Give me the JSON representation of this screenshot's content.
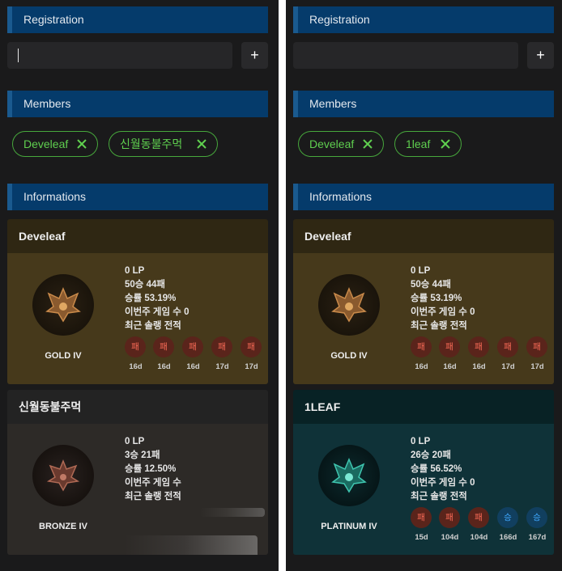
{
  "left": {
    "registration": {
      "title": "Registration",
      "input_value": "",
      "add_label": "+"
    },
    "members": {
      "title": "Members",
      "chips": [
        {
          "label": "Develeaf"
        },
        {
          "label": "신월동불주먹"
        }
      ]
    },
    "info": {
      "title": "Informations"
    },
    "cards": [
      {
        "name": "Develeaf",
        "theme": "gold",
        "tier": "GOLD IV",
        "lp": "0 LP",
        "record": "50승 44패",
        "winrate": "승률 53.19%",
        "week_games": "이번주 게임 수  0",
        "recent_label": "최근 솔랭 전적",
        "games": [
          {
            "result": "패",
            "ago": "16d"
          },
          {
            "result": "패",
            "ago": "16d"
          },
          {
            "result": "패",
            "ago": "16d"
          },
          {
            "result": "패",
            "ago": "17d"
          },
          {
            "result": "패",
            "ago": "17d"
          }
        ]
      },
      {
        "name": "신월동불주먹",
        "theme": "bronze",
        "tier": "BRONZE IV",
        "lp": "0 LP",
        "record": "3승 21패",
        "winrate": "승률 12.50%",
        "week_games": "이번주 게임 수",
        "recent_label": "최근 솔랭 전적",
        "loading": true
      }
    ]
  },
  "right": {
    "registration": {
      "title": "Registration",
      "input_value": "",
      "add_label": "+"
    },
    "members": {
      "title": "Members",
      "chips": [
        {
          "label": "Develeaf"
        },
        {
          "label": "1leaf"
        }
      ]
    },
    "info": {
      "title": "Informations"
    },
    "cards": [
      {
        "name": "Develeaf",
        "theme": "gold",
        "tier": "GOLD IV",
        "lp": "0 LP",
        "record": "50승 44패",
        "winrate": "승률 53.19%",
        "week_games": "이번주 게임 수  0",
        "recent_label": "최근 솔랭 전적",
        "games": [
          {
            "result": "패",
            "ago": "16d"
          },
          {
            "result": "패",
            "ago": "16d"
          },
          {
            "result": "패",
            "ago": "16d"
          },
          {
            "result": "패",
            "ago": "17d"
          },
          {
            "result": "패",
            "ago": "17d"
          }
        ]
      },
      {
        "name": "1LEAF",
        "theme": "plat",
        "tier": "PLATINUM IV",
        "lp": "0 LP",
        "record": "26승 20패",
        "winrate": "승률 56.52%",
        "week_games": "이번주 게임 수  0",
        "recent_label": "최근 솔랭 전적",
        "games": [
          {
            "result": "패",
            "ago": "15d"
          },
          {
            "result": "패",
            "ago": "104d"
          },
          {
            "result": "패",
            "ago": "104d"
          },
          {
            "result": "승",
            "ago": "166d"
          },
          {
            "result": "승",
            "ago": "167d"
          }
        ]
      }
    ]
  },
  "colors": {
    "header_bg": "#053b6b",
    "chip_green": "#5fcf4f",
    "loss": "#ff6d59",
    "win": "#3fa8ff",
    "gold_emblem": "#c98a4a",
    "bronze_emblem": "#b06a55",
    "plat_emblem": "#3fc6b0"
  },
  "icons": {
    "chip_remove": "close-icon",
    "emblem": "rank-emblem-icon"
  }
}
